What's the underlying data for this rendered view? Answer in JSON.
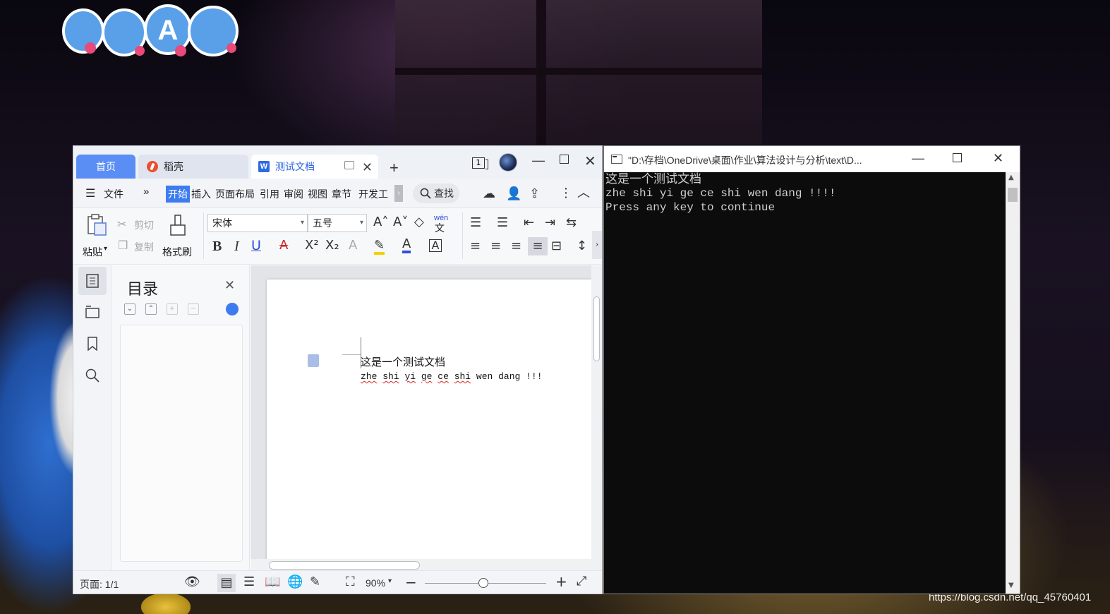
{
  "wps": {
    "tabs": [
      {
        "label": "首页"
      },
      {
        "label": "稻壳"
      },
      {
        "label": "测试文档"
      }
    ],
    "window_count_badge": "1",
    "menu": {
      "file": "文件",
      "items": [
        "开始",
        "插入",
        "页面布局",
        "引用",
        "审阅",
        "视图",
        "章节",
        "开发工"
      ],
      "active": "开始",
      "search": "查找"
    },
    "ribbon": {
      "paste": "粘贴",
      "cut": "剪切",
      "copy": "复制",
      "format_painter": "格式刷",
      "font_name": "宋体",
      "font_size": "五号",
      "phonetic": "wén"
    },
    "toc": {
      "title": "目录"
    },
    "document": {
      "line1": "这是一个测试文档",
      "line2_words": [
        "zhe",
        "shi",
        "yi",
        "ge",
        "ce",
        "shi"
      ],
      "line2_tail": "wen dang !!!"
    },
    "status": {
      "page": "页面: 1/1",
      "zoom": "90%",
      "zoom_level": 0.48
    },
    "colors": {
      "accent": "#3d7bf0",
      "tab_home": "#5a8ef4",
      "highlight": "#f5d000",
      "font_color": "#2f4fd8"
    }
  },
  "console": {
    "title": "\"D:\\存档\\OneDrive\\桌面\\作业\\算法设计与分析\\text\\D...",
    "lines": [
      "这是一个测试文档",
      "zhe shi yi ge ce shi wen dang !!!!",
      "Press any key to continue"
    ]
  },
  "desktop": {
    "watermark": "https://blog.csdn.net/qq_45760401"
  }
}
